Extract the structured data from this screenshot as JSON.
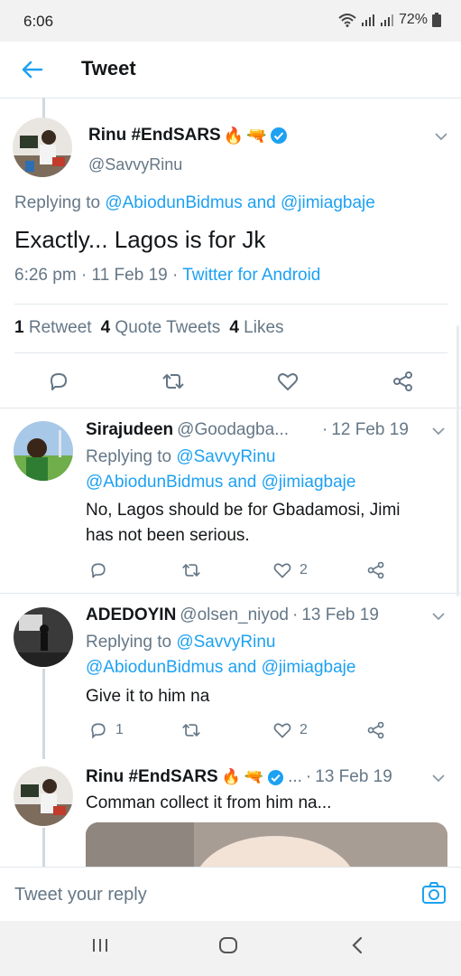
{
  "status_bar": {
    "time": "6:06",
    "battery": "72%"
  },
  "header": {
    "title": "Tweet"
  },
  "main_tweet": {
    "author": "Rinu #EndSARS",
    "emojis": [
      "fire-emoji",
      "water-gun-emoji"
    ],
    "handle": "@SavvyRinu",
    "replying_label": "Replying to",
    "replying_to_1": "@AbiodunBidmus",
    "replying_and": "and",
    "replying_to_2": "@jimiagbaje",
    "text": "Exactly... Lagos is for Jk",
    "time": "6:26 pm",
    "date": "11 Feb 19",
    "source": "Twitter for Android",
    "retweet_count": "1",
    "retweet_label": "Retweet",
    "quote_count": "4",
    "quote_label": "Quote Tweets",
    "like_count": "4",
    "like_label": "Likes"
  },
  "replies": [
    {
      "author": "Sirajudeen",
      "handle": "@Goodagba...",
      "date": "12 Feb 19",
      "replying_label": "Replying to",
      "replying_to_1": "@SavvyRinu",
      "replying_to_2": "@AbiodunBidmus",
      "replying_and": "and",
      "replying_to_3": "@jimiagbaje",
      "text_line1": "No, Lagos should be for Gbadamosi, Jimi",
      "text_line2": "has not been serious.",
      "reply_count": "",
      "like_count": "2"
    },
    {
      "author": "ADEDOYIN",
      "handle": "@olsen_niyod",
      "date": "13 Feb 19",
      "replying_label": "Replying to",
      "replying_to_1": "@SavvyRinu",
      "replying_to_2": "@AbiodunBidmus",
      "replying_and": "and",
      "replying_to_3": "@jimiagbaje",
      "text_line1": "Give it to him na",
      "reply_count": "1",
      "like_count": "2"
    },
    {
      "author": "Rinu #EndSARS",
      "handle": "...",
      "date": "13 Feb 19",
      "text_line1": "Comman collect it from him na..."
    }
  ],
  "reply_bar": {
    "placeholder": "Tweet your reply"
  },
  "colors": {
    "link": "#1da1f2",
    "muted": "#657786",
    "text": "#14171a",
    "verified": "#1da1f2"
  }
}
